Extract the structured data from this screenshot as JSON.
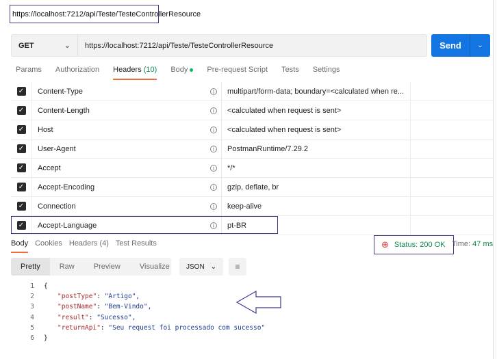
{
  "top_url": "https://localhost:7212/api/Teste/TesteControllerResource",
  "request": {
    "method": "GET",
    "url": "https://localhost:7212/api/Teste/TesteControllerResource",
    "send": "Send"
  },
  "tabs": [
    {
      "label": "Params"
    },
    {
      "label": "Authorization"
    },
    {
      "label": "Headers",
      "count": "(10)"
    },
    {
      "label": "Body"
    },
    {
      "label": "Pre-request Script"
    },
    {
      "label": "Tests"
    },
    {
      "label": "Settings"
    }
  ],
  "headers": [
    {
      "key": "Content-Type",
      "value": "multipart/form-data; boundary=<calculated when re..."
    },
    {
      "key": "Content-Length",
      "value": "<calculated when request is sent>"
    },
    {
      "key": "Host",
      "value": "<calculated when request is sent>"
    },
    {
      "key": "User-Agent",
      "value": "PostmanRuntime/7.29.2"
    },
    {
      "key": "Accept",
      "value": "*/*"
    },
    {
      "key": "Accept-Encoding",
      "value": "gzip, deflate, br"
    },
    {
      "key": "Connection",
      "value": "keep-alive"
    },
    {
      "key": "Accept-Language",
      "value": "pt-BR"
    }
  ],
  "response": {
    "tabs": [
      "Body",
      "Cookies",
      "Headers (4)",
      "Test Results"
    ],
    "status": "Status: 200 OK",
    "time_label": "Time:",
    "time": "47 ms",
    "views": [
      "Pretty",
      "Raw",
      "Preview",
      "Visualize"
    ],
    "format": "JSON",
    "lines": [
      {
        "n": "1",
        "text": "{"
      },
      {
        "n": "2",
        "key": "\"postType\"",
        "val": "\"Artigo\","
      },
      {
        "n": "3",
        "key": "\"postName\"",
        "val": "\"Bem-Vindo\","
      },
      {
        "n": "4",
        "key": "\"result\"",
        "val": "\"Sucesso\","
      },
      {
        "n": "5",
        "key": "\"returnApi\"",
        "val": "\"Seu request foi processado com sucesso\""
      },
      {
        "n": "6",
        "text": "}"
      }
    ]
  },
  "colors": {
    "accent": "#1275e2",
    "tab_underline": "#f26b3a",
    "status": "#0f8a4f",
    "annotation": "#3b3b8c"
  }
}
